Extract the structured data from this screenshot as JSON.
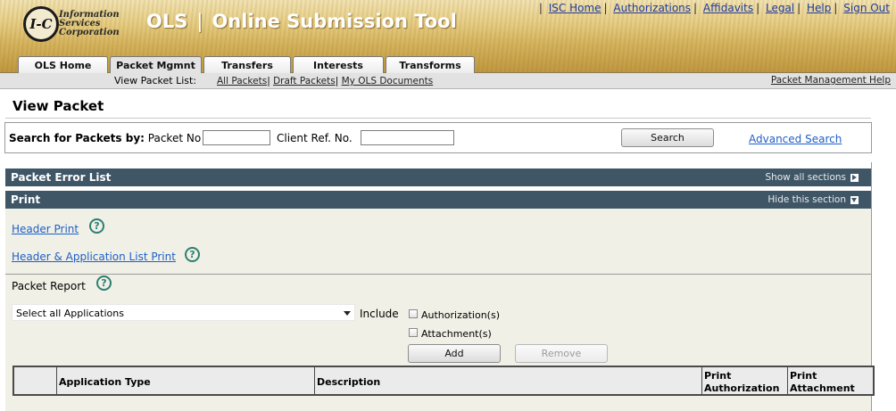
{
  "banner": {
    "logo": {
      "initials": "I-C",
      "line1": "Information",
      "line2": "Services",
      "line3": "Corporation"
    },
    "app_short": "OLS",
    "app_name": "Online Submission Tool",
    "top_links": [
      "ISC Home",
      "Authorizations",
      "Affidavits",
      "Legal",
      "Help",
      "Sign Out"
    ]
  },
  "tabs": [
    {
      "label": "OLS Home",
      "active": false
    },
    {
      "label": "Packet Mgmnt",
      "active": true
    },
    {
      "label": "Transfers",
      "active": false
    },
    {
      "label": "Interests",
      "active": false
    },
    {
      "label": "Transforms",
      "active": false
    }
  ],
  "subnav": {
    "label": "View Packet List:",
    "links": [
      "All Packets",
      "Draft Packets",
      "My OLS Documents"
    ],
    "help": "Packet Management Help"
  },
  "page": {
    "title": "View Packet"
  },
  "search": {
    "label_bold": "Search for Packets by:",
    "packet_no_label": "Packet No",
    "packet_no_value": "",
    "client_ref_label": "Client Ref. No.",
    "client_ref_value": "",
    "search_button": "Search",
    "advanced_link": "Advanced Search"
  },
  "sections": {
    "error_list": {
      "title": "Packet Error List",
      "toggle": "Show all sections"
    },
    "print": {
      "title": "Print",
      "toggle": "Hide this section"
    }
  },
  "print": {
    "header_print": "Header Print",
    "header_app_print": "Header & Application List Print",
    "help_glyph": "?",
    "packet_report": "Packet Report",
    "select_value": "Select all Applications",
    "include_label": "Include",
    "checkboxes": [
      {
        "label": "Authorization(s)",
        "checked": false
      },
      {
        "label": "Attachment(s)",
        "checked": false
      }
    ],
    "add_button": "Add",
    "remove_button": "Remove",
    "table_headers": {
      "blank": "",
      "app_type": "Application Type",
      "description": "Description",
      "print_auth_l1": "Print",
      "print_auth_l2": "Authorization",
      "print_att_l1": "Print",
      "print_att_l2": "Attachment"
    }
  },
  "colors": {
    "section_bar": "#3f5667",
    "link": "#1f5fc8",
    "print_bg": "#f0f0e6",
    "help_icon": "#2e7f73"
  }
}
